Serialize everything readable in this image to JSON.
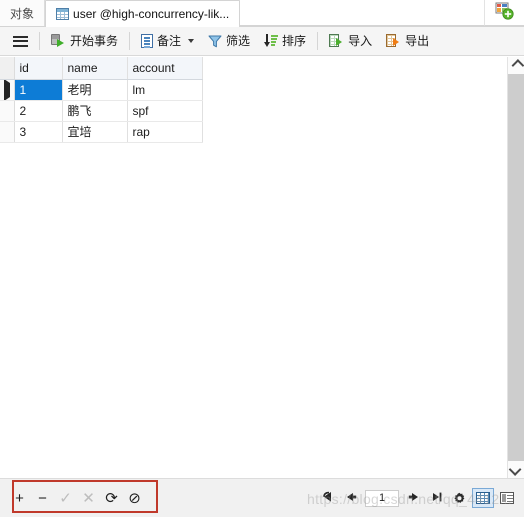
{
  "tabs": [
    {
      "label": "对象",
      "icon": null,
      "active": false
    },
    {
      "label": "user @high-concurrency-lik...",
      "icon": "grid-table-icon",
      "active": true
    }
  ],
  "newtab": {
    "icon": "add-object-icon",
    "label": ""
  },
  "toolbar": {
    "menu": {
      "label": "",
      "icon": "hamburger-icon"
    },
    "items": [
      {
        "label": "开始事务",
        "icon": "begin-transaction-icon",
        "has_caret": false
      },
      {
        "label": "备注",
        "icon": "note-icon",
        "has_caret": true
      },
      {
        "label": "筛选",
        "icon": "filter-funnel-icon",
        "has_caret": false
      },
      {
        "label": "排序",
        "icon": "sort-icon",
        "has_caret": false
      },
      {
        "label": "导入",
        "icon": "import-icon",
        "has_caret": false
      },
      {
        "label": "导出",
        "icon": "export-icon",
        "has_caret": false
      }
    ]
  },
  "grid": {
    "columns": [
      "id",
      "name",
      "account"
    ],
    "rows": [
      {
        "marker": "current-row-pointer",
        "cells": [
          "1",
          "老明",
          "lm"
        ],
        "selected_cell": 0
      },
      {
        "marker": "",
        "cells": [
          "2",
          "鹏飞",
          "spf"
        ],
        "selected_cell": -1
      },
      {
        "marker": "",
        "cells": [
          "3",
          "宜培",
          "rap"
        ],
        "selected_cell": -1
      }
    ],
    "selection_color": "#0d7cd6",
    "header_bg": "#f3f6fa"
  },
  "bottombar": {
    "record_buttons": [
      {
        "name": "add-record-button",
        "glyph": "+",
        "enabled": true
      },
      {
        "name": "delete-record-button",
        "glyph": "−",
        "enabled": true
      },
      {
        "name": "apply-change-button",
        "glyph": "✓",
        "enabled": false
      },
      {
        "name": "cancel-change-button",
        "glyph": "✕",
        "enabled": false
      },
      {
        "name": "refresh-button",
        "glyph": "⟳",
        "enabled": true
      },
      {
        "name": "stop-button",
        "glyph": "⊘",
        "enabled": true
      }
    ],
    "nav_buttons": [
      {
        "name": "first-record-button",
        "icon": "first-record-icon"
      },
      {
        "name": "previous-record-button",
        "icon": "previous-record-icon"
      },
      {
        "name": "next-record-button",
        "icon": "next-record-icon"
      },
      {
        "name": "last-record-button",
        "icon": "last-record-icon"
      },
      {
        "name": "settings-button",
        "icon": "gear-icon"
      }
    ],
    "page_value": "1",
    "page_placeholder": "1",
    "view_buttons": [
      {
        "name": "grid-view-button",
        "icon": "grid-view-icon",
        "selected": true
      },
      {
        "name": "form-view-button",
        "icon": "form-view-icon",
        "selected": false
      }
    ]
  },
  "scrollbar": {
    "up_icon": "chevron-up-icon",
    "down_icon": "chevron-down-icon"
  },
  "watermark": {
    "text": "https://blog.csdn.net/qq_4412..."
  },
  "annotation": {
    "color": "#c0392b",
    "target": "record-buttons-group"
  }
}
